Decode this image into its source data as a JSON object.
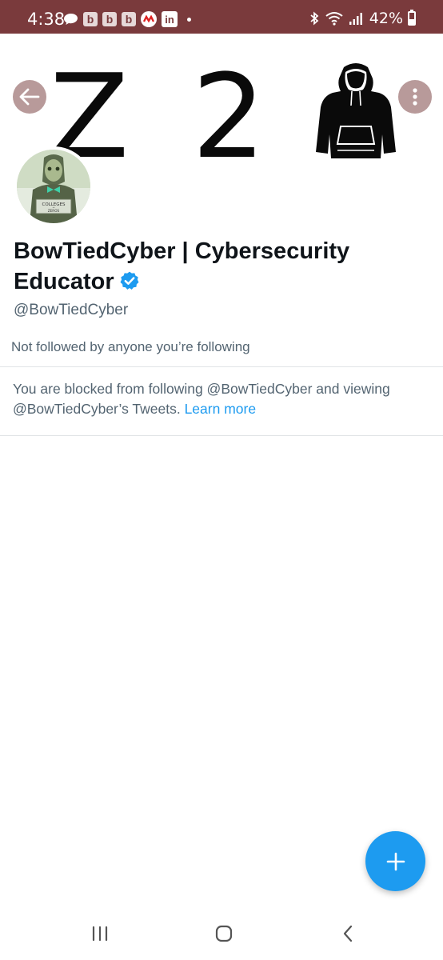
{
  "status_bar": {
    "time": "4:38",
    "battery": "42%",
    "notification_icons": [
      "chat-bubble-icon",
      "b-app-icon",
      "b-app-icon",
      "b-app-icon",
      "red-app-icon",
      "linkedin-icon",
      "dot-icon"
    ],
    "system_icons": [
      "bluetooth-icon",
      "wifi-icon",
      "signal-icon",
      "battery-icon"
    ],
    "background_color": "#7a3a3c",
    "b_letter": "b",
    "linkedin_letters": "in"
  },
  "banner": {
    "text_left": "Z",
    "text_right": "2"
  },
  "profile": {
    "display_name": "BowTiedCyber | Cybersecurity Educator",
    "handle": "@BowTiedCyber",
    "verified": true,
    "followers_note": "Not followed by anyone you’re following",
    "avatar_sign_text": [
      "COLLEGES",
      "→",
      "ZEROS"
    ]
  },
  "blocked_notice": {
    "text": "You are blocked from following @BowTiedCyber and viewing @BowTiedCyber’s Tweets.",
    "link_text": "Learn more"
  },
  "colors": {
    "accent": "#1d9bf0",
    "secondary_text": "#536471",
    "primary_text": "#0f1419"
  },
  "icons": {
    "back": "back-arrow-icon",
    "more": "more-vertical-icon",
    "verified": "verified-badge-icon",
    "compose": "plus-icon",
    "nav_recents": "recents-icon",
    "nav_home": "home-icon",
    "nav_back": "back-chevron-icon"
  }
}
